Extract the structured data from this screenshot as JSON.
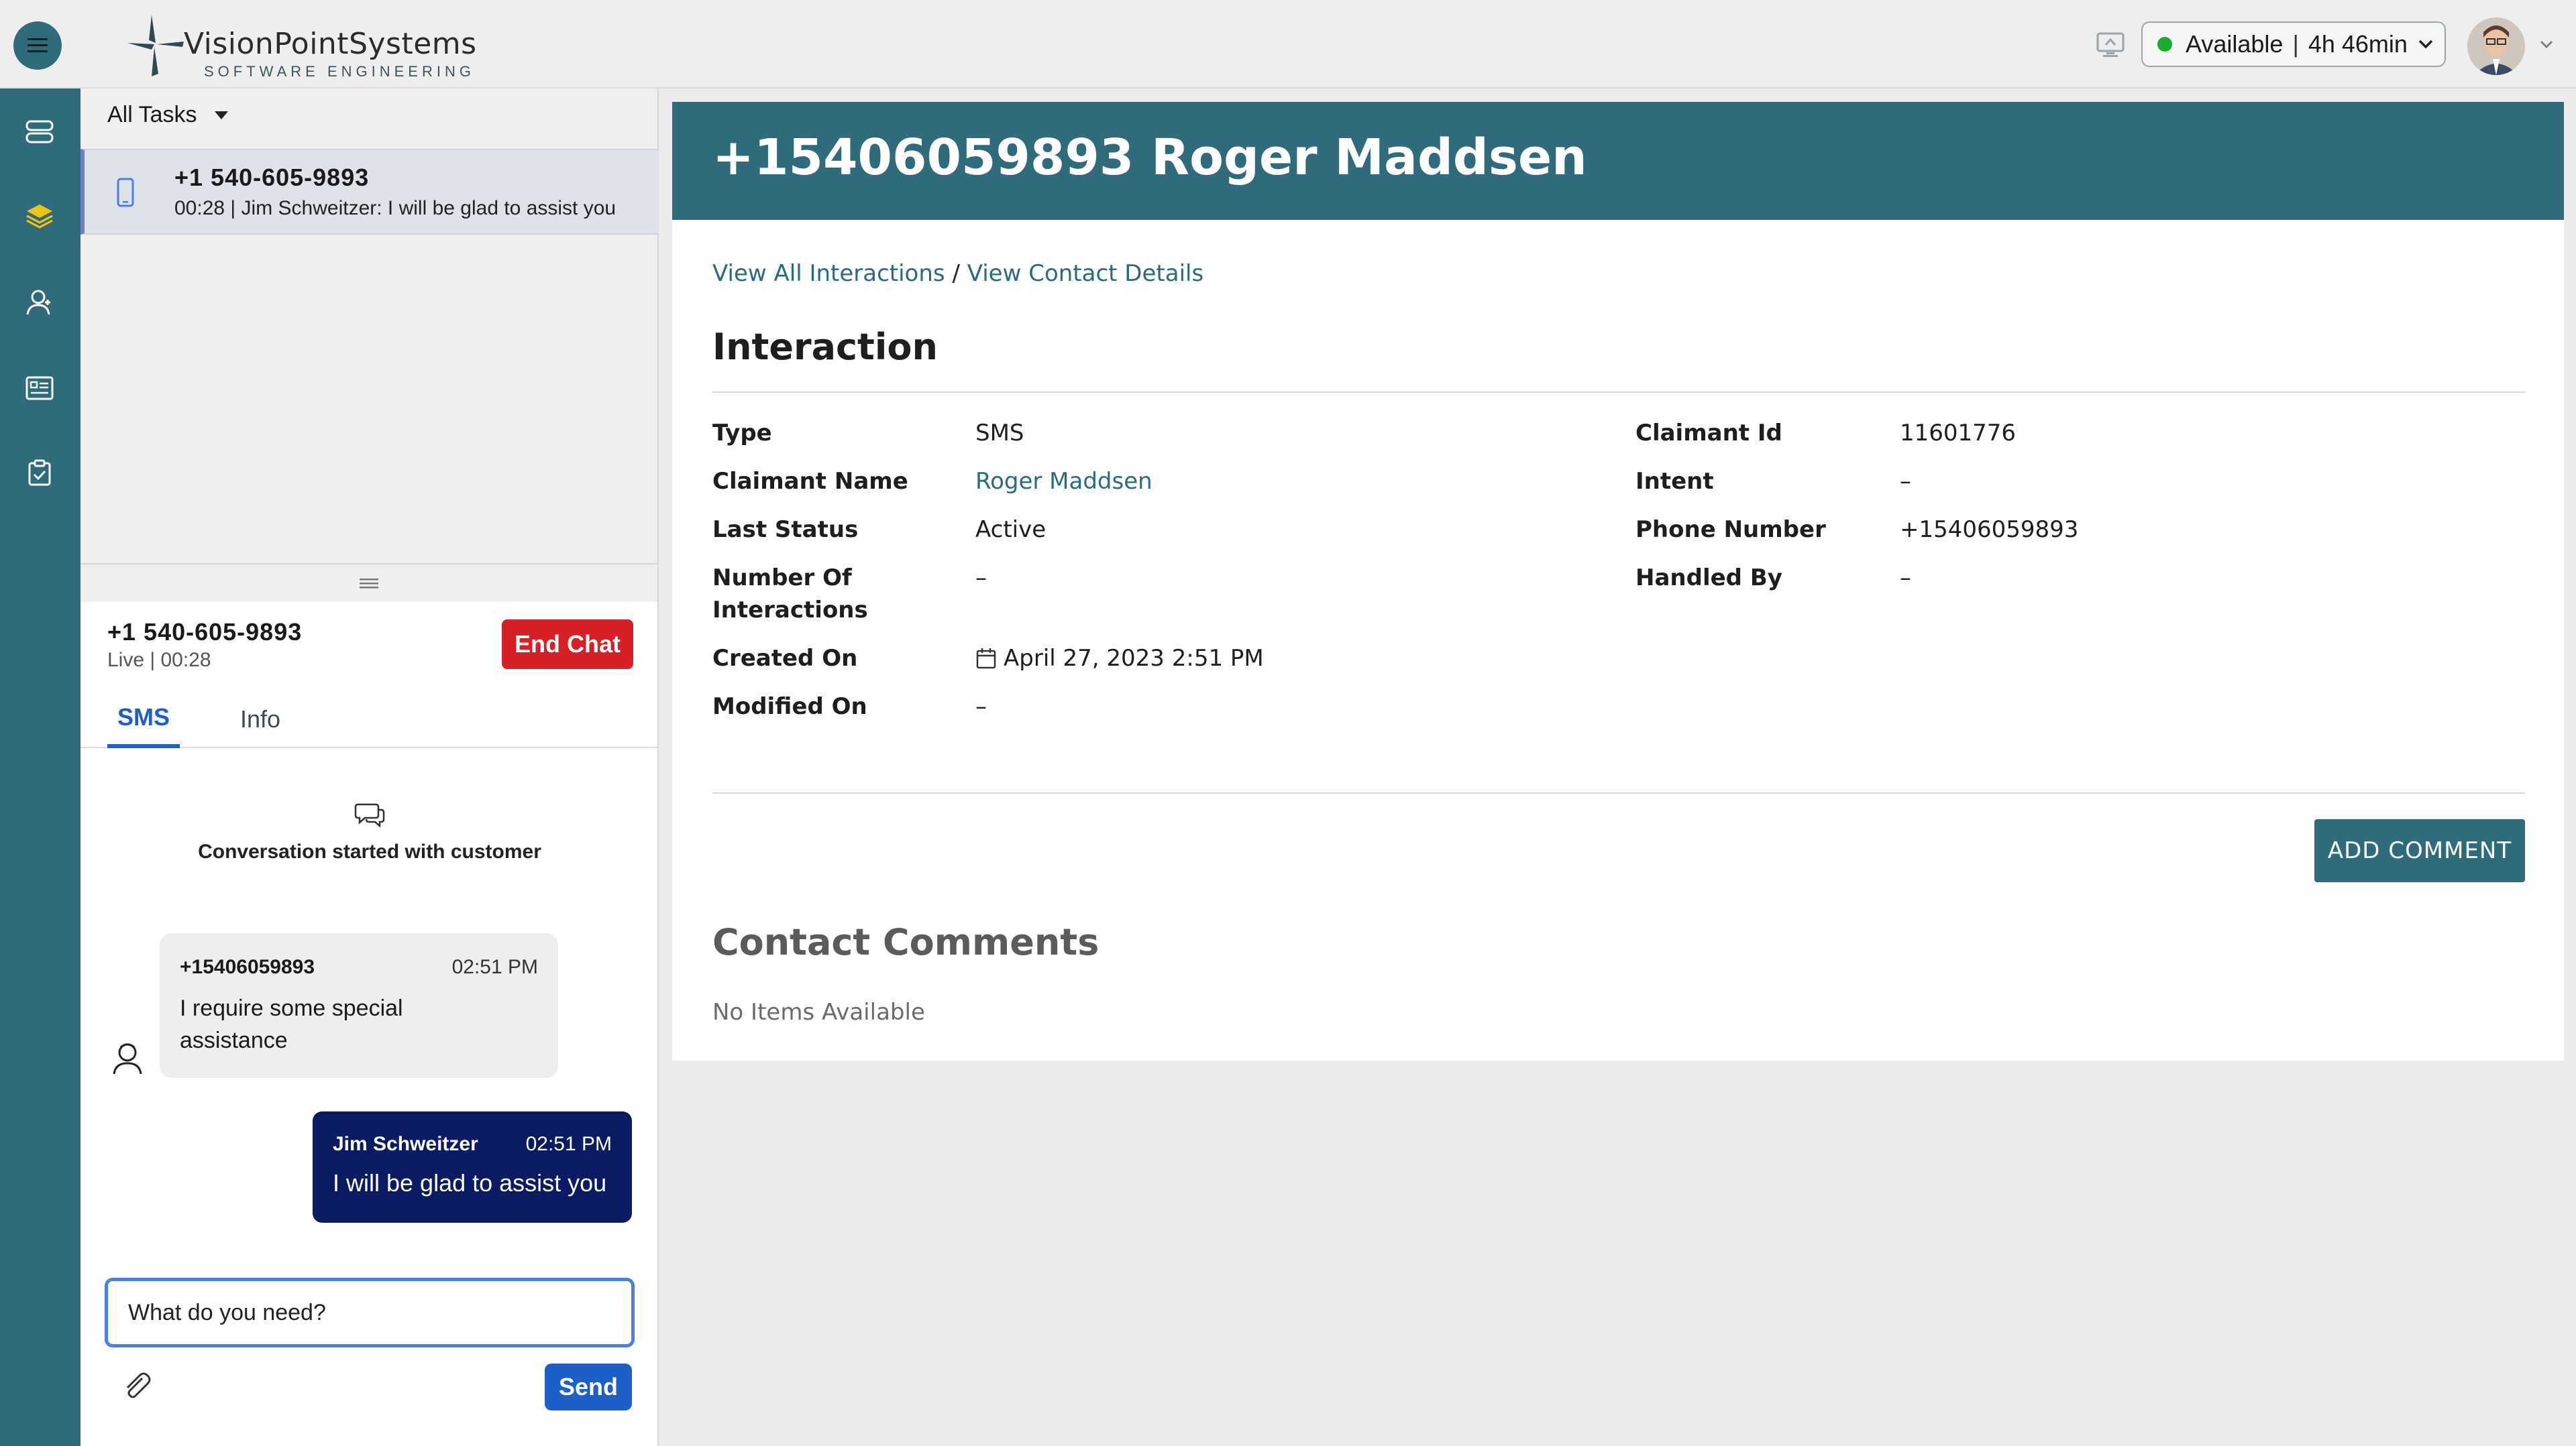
{
  "brand": {
    "name_part1": "Vision",
    "name_part2": "Point",
    "name_part3": "Systems",
    "tagline": "SOFTWARE ENGINEERING"
  },
  "topbar": {
    "status": "Available",
    "timer": "4h 46min",
    "status_color": "#1bab2e"
  },
  "nav": {
    "items": [
      {
        "icon": "servers-icon"
      },
      {
        "icon": "layers-icon",
        "active": true
      },
      {
        "icon": "contacts-icon"
      },
      {
        "icon": "id-card-icon"
      },
      {
        "icon": "clipboard-check-icon"
      }
    ]
  },
  "tasks": {
    "filter_label": "All Tasks",
    "items": [
      {
        "title": "+1 540-605-9893",
        "subtitle": "00:28 | Jim Schweitzer: I will be glad to assist you"
      }
    ]
  },
  "chat": {
    "phone": "+1 540-605-9893",
    "status_line": "Live | 00:28",
    "end_label": "End Chat",
    "tabs": [
      "SMS",
      "Info"
    ],
    "conversation_started": "Conversation started with customer",
    "messages": [
      {
        "sender": "+15406059893",
        "time": "02:51 PM",
        "text": "I require some special assistance"
      },
      {
        "sender": "Jim Schweitzer",
        "time": "02:51 PM",
        "text": "I will be glad to assist you"
      }
    ],
    "input_value": "What do you need?",
    "send_label": "Send"
  },
  "content": {
    "title": "+15406059893 Roger Maddsen",
    "breadcrumb_all": "View All Interactions",
    "breadcrumb_sep": "/",
    "breadcrumb_contact": "View Contact Details",
    "section_title": "Interaction",
    "fields_left": [
      {
        "label": "Type",
        "value": "SMS"
      },
      {
        "label": "Claimant Name",
        "value": "Roger Maddsen"
      },
      {
        "label": "Last Status",
        "value": "Active"
      },
      {
        "label": "Number Of Interactions",
        "value": "–"
      },
      {
        "label": "Created On",
        "value": "April 27, 2023 2:51 PM"
      },
      {
        "label": "Modified On",
        "value": "–"
      }
    ],
    "fields_right": [
      {
        "label": "Claimant Id",
        "value": "11601776"
      },
      {
        "label": "Intent",
        "value": "–"
      },
      {
        "label": "Phone Number",
        "value": "+15406059893"
      },
      {
        "label": "Handled By",
        "value": "–"
      }
    ],
    "add_comment_label": "ADD COMMENT",
    "comments_title": "Contact Comments",
    "no_items": "No Items Available"
  },
  "colors": {
    "primary": "#2f6b7a",
    "danger": "#d81f26",
    "accent_blue": "#1d5fc9",
    "outgoing_bubble": "#0b1b63"
  }
}
